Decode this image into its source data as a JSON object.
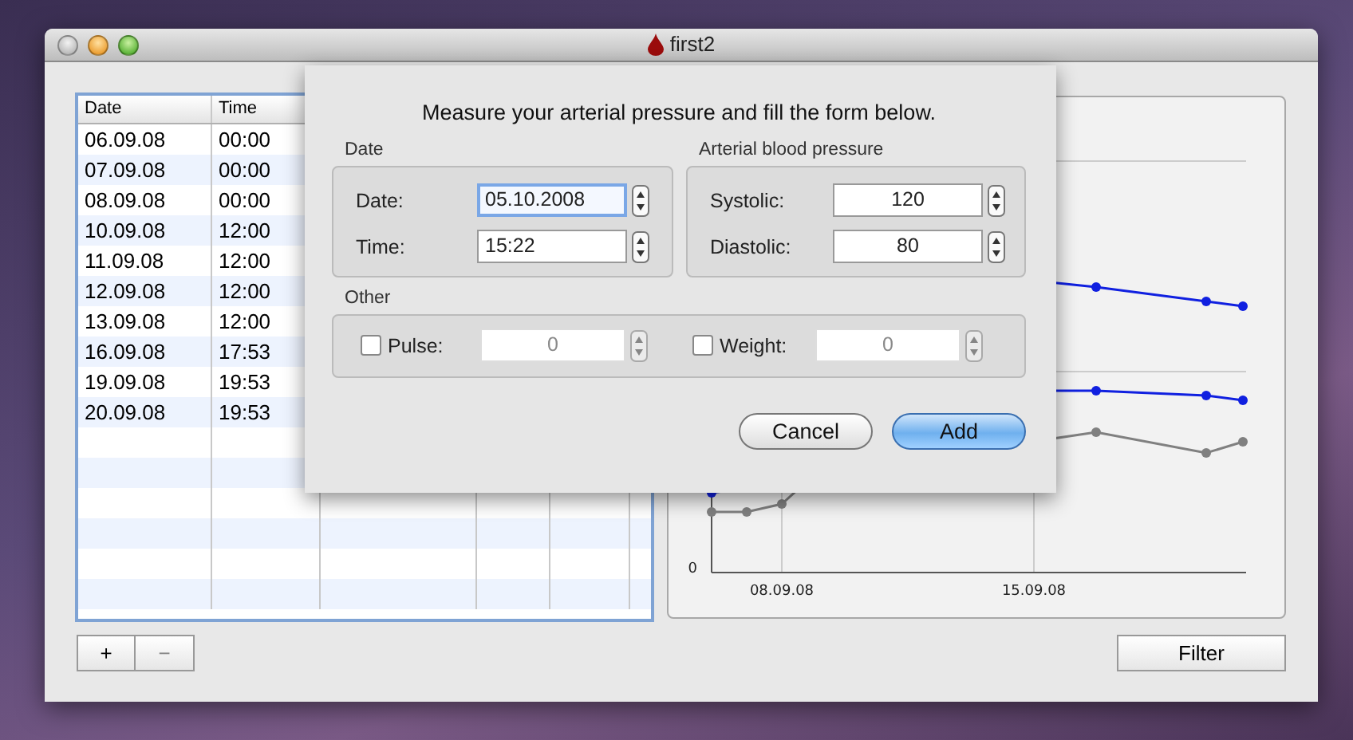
{
  "window": {
    "title": "first2"
  },
  "table": {
    "columns": [
      "Date",
      "Time"
    ],
    "rows": [
      [
        "06.09.08",
        "00:00"
      ],
      [
        "07.09.08",
        "00:00"
      ],
      [
        "08.09.08",
        "00:00"
      ],
      [
        "10.09.08",
        "12:00"
      ],
      [
        "11.09.08",
        "12:00"
      ],
      [
        "12.09.08",
        "12:00"
      ],
      [
        "13.09.08",
        "12:00"
      ],
      [
        "16.09.08",
        "17:53"
      ],
      [
        "19.09.08",
        "19:53"
      ],
      [
        "20.09.08",
        "19:53"
      ]
    ]
  },
  "chart": {
    "y_tick_labels": [
      "0"
    ],
    "x_tick_labels": [
      "08.09.08",
      "15.09.08"
    ]
  },
  "bottom_bar": {
    "add": "+",
    "remove": "−",
    "filter": "Filter"
  },
  "sheet": {
    "message": "Measure your arterial pressure and fill the form below.",
    "date_group": {
      "title": "Date",
      "fields": [
        {
          "label": "Date:",
          "value": "05.10.2008",
          "focused": true
        },
        {
          "label": "Time:",
          "value": "15:22",
          "focused": false
        }
      ]
    },
    "pressure_group": {
      "title": "Arterial blood pressure",
      "fields": [
        {
          "label": "Systolic:",
          "value": "120"
        },
        {
          "label": "Diastolic:",
          "value": "80"
        }
      ]
    },
    "other_group": {
      "title": "Other",
      "fields": [
        {
          "label": "Pulse:",
          "value": "0",
          "checked": false,
          "disabled": true
        },
        {
          "label": "Weight:",
          "value": "0",
          "checked": false,
          "disabled": true
        }
      ]
    },
    "buttons": [
      {
        "label": "Cancel",
        "primary": false
      },
      {
        "label": "Add",
        "primary": true
      }
    ]
  }
}
